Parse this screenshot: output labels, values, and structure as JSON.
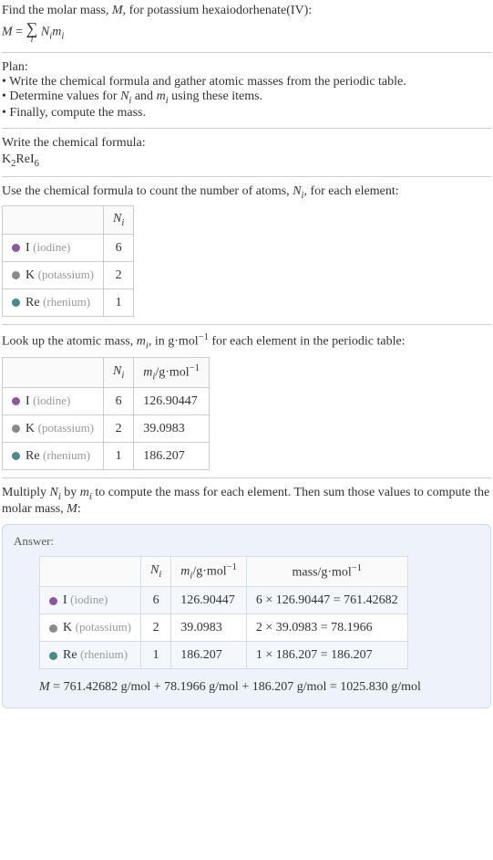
{
  "problem": {
    "line1": "Find the molar mass, ",
    "M": "M",
    "line1b": ", for potassium hexaiodorhenate(IV):",
    "eq_lhs_M": "M",
    "eq_eq": " = ",
    "eq_sigma_sub": "i",
    "eq_N": "N",
    "eq_N_sub": "i",
    "eq_m": "m",
    "eq_m_sub": "i"
  },
  "plan": {
    "title": "Plan:",
    "b1": "• Write the chemical formula and gather atomic masses from the periodic table.",
    "b2a": "• Determine values for ",
    "b2_N": "N",
    "b2_Ni": "i",
    "b2b": " and ",
    "b2_m": "m",
    "b2_mi": "i",
    "b2c": " using these items.",
    "b3": "• Finally, compute the mass."
  },
  "formula_section": {
    "title": "Write the chemical formula:",
    "f_K": "K",
    "f_K2": "2",
    "f_Re": "Re",
    "f_I": "I",
    "f_I6": "6"
  },
  "count_section": {
    "title_a": "Use the chemical formula to count the number of atoms, ",
    "title_N": "N",
    "title_Ni": "i",
    "title_b": ", for each element:",
    "th_Ni": "N",
    "th_Ni_sub": "i",
    "rows": [
      {
        "sym": "I",
        "name": "(iodine)",
        "n": "6",
        "dot": "dot-purple"
      },
      {
        "sym": "K",
        "name": "(potassium)",
        "n": "2",
        "dot": "dot-gray"
      },
      {
        "sym": "Re",
        "name": "(rhenium)",
        "n": "1",
        "dot": "dot-teal"
      }
    ]
  },
  "mass_section": {
    "title_a": "Look up the atomic mass, ",
    "title_m": "m",
    "title_mi": "i",
    "title_b": ", in g·mol",
    "title_exp": "−1",
    "title_c": " for each element in the periodic table:",
    "th_Ni": "N",
    "th_Ni_sub": "i",
    "th_mi": "m",
    "th_mi_sub": "i",
    "th_unit": "/g·mol",
    "th_unit_exp": "−1",
    "rows": [
      {
        "sym": "I",
        "name": "(iodine)",
        "n": "6",
        "m": "126.90447",
        "dot": "dot-purple"
      },
      {
        "sym": "K",
        "name": "(potassium)",
        "n": "2",
        "m": "39.0983",
        "dot": "dot-gray"
      },
      {
        "sym": "Re",
        "name": "(rhenium)",
        "n": "1",
        "m": "186.207",
        "dot": "dot-teal"
      }
    ]
  },
  "multiply_section": {
    "text_a": "Multiply ",
    "N": "N",
    "Ni": "i",
    "text_b": " by ",
    "m": "m",
    "mi": "i",
    "text_c": " to compute the mass for each element. Then sum those values to compute the molar mass, ",
    "M": "M",
    "text_d": ":"
  },
  "answer": {
    "title": "Answer:",
    "th_Ni": "N",
    "th_Ni_sub": "i",
    "th_mi": "m",
    "th_mi_sub": "i",
    "th_mi_unit": "/g·mol",
    "th_mi_exp": "−1",
    "th_mass": "mass/g·mol",
    "th_mass_exp": "−1",
    "rows": [
      {
        "sym": "I",
        "name": "(iodine)",
        "n": "6",
        "m": "126.90447",
        "calc": "6 × 126.90447 = 761.42682",
        "dot": "dot-purple"
      },
      {
        "sym": "K",
        "name": "(potassium)",
        "n": "2",
        "m": "39.0983",
        "calc": "2 × 39.0983 = 78.1966",
        "dot": "dot-gray"
      },
      {
        "sym": "Re",
        "name": "(rhenium)",
        "n": "1",
        "m": "186.207",
        "calc": "1 × 186.207 = 186.207",
        "dot": "dot-teal"
      }
    ],
    "final_M": "M",
    "final_eq": " = 761.42682 g/mol + 78.1966 g/mol + 186.207 g/mol = 1025.830 g/mol"
  }
}
